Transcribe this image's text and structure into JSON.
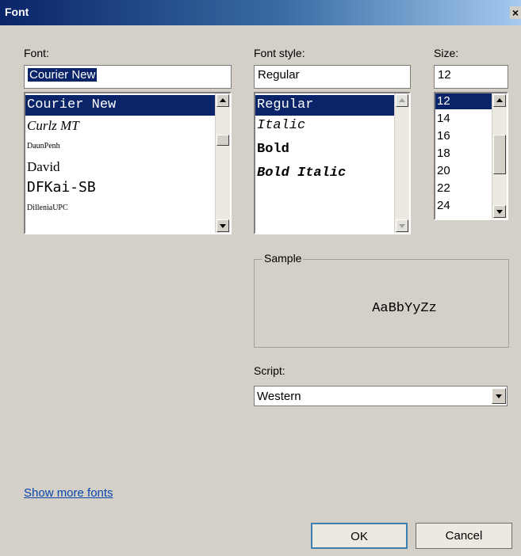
{
  "window": {
    "title": "Font",
    "close_glyph": "×"
  },
  "font": {
    "label": "Font:",
    "value": "Courier New",
    "items": [
      "Courier New",
      "Curlz MT",
      "DaunPenh",
      "David",
      "DFKai-SB",
      "DilleniaUPC"
    ],
    "selected_index": 0
  },
  "style": {
    "label": "Font style:",
    "value": "Regular",
    "items": [
      "Regular",
      "Italic",
      "Bold",
      "Bold Italic"
    ],
    "selected_index": 0
  },
  "size": {
    "label": "Size:",
    "value": "12",
    "items": [
      "12",
      "14",
      "16",
      "18",
      "20",
      "22",
      "24"
    ],
    "selected_index": 0
  },
  "sample": {
    "label": "Sample",
    "text": "AaBbYyZz"
  },
  "script": {
    "label": "Script:",
    "value": "Western"
  },
  "link": "Show more fonts",
  "buttons": {
    "ok": "OK",
    "cancel": "Cancel"
  },
  "colors": {
    "selection": "#0a246a",
    "dialog_bg": "#d4d0c8",
    "link": "#0645ad"
  },
  "icons": {
    "close": "close-icon",
    "scroll_up": "arrow-up-icon",
    "scroll_down": "arrow-down-icon"
  }
}
